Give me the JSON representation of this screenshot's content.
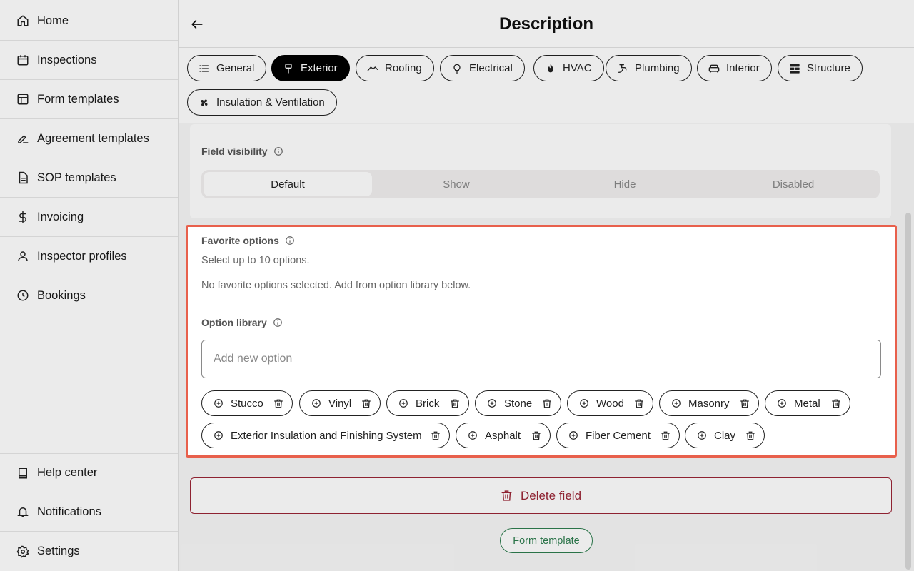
{
  "sidebar": {
    "items": [
      {
        "label": "Home",
        "icon": "home-icon"
      },
      {
        "label": "Inspections",
        "icon": "calendar-icon"
      },
      {
        "label": "Form templates",
        "icon": "layout-icon"
      },
      {
        "label": "Agreement templates",
        "icon": "signature-icon"
      },
      {
        "label": "SOP templates",
        "icon": "document-icon"
      },
      {
        "label": "Invoicing",
        "icon": "dollar-icon"
      },
      {
        "label": "Inspector profiles",
        "icon": "user-icon"
      },
      {
        "label": "Bookings",
        "icon": "clock-icon"
      }
    ],
    "bottom_items": [
      {
        "label": "Help center",
        "icon": "book-icon"
      },
      {
        "label": "Notifications",
        "icon": "bell-icon"
      },
      {
        "label": "Settings",
        "icon": "gear-icon"
      }
    ]
  },
  "header": {
    "title": "Description"
  },
  "tabs": [
    {
      "label": "General",
      "icon": "list-icon"
    },
    {
      "label": "Exterior",
      "icon": "brush-icon",
      "active": true
    },
    {
      "label": "Roofing",
      "icon": "roof-icon"
    },
    {
      "label": "Electrical",
      "icon": "lightbulb-icon"
    },
    {
      "label": "HVAC",
      "icon": "flame-icon"
    },
    {
      "label": "Plumbing",
      "icon": "faucet-icon"
    },
    {
      "label": "Interior",
      "icon": "sofa-icon"
    },
    {
      "label": "Structure",
      "icon": "bricks-icon"
    },
    {
      "label": "Insulation & Ventilation",
      "icon": "fan-icon"
    }
  ],
  "field_visibility": {
    "label": "Field visibility",
    "options": [
      "Default",
      "Show",
      "Hide",
      "Disabled"
    ],
    "selected": "Default"
  },
  "favorite_options": {
    "label": "Favorite options",
    "hint": "Select up to 10 options.",
    "empty_text": "No favorite options selected. Add from option library below."
  },
  "option_library": {
    "label": "Option library",
    "input_placeholder": "Add new option",
    "options": [
      "Stucco",
      "Vinyl",
      "Brick",
      "Stone",
      "Wood",
      "Masonry",
      "Metal",
      "Exterior Insulation and Finishing System",
      "Asphalt",
      "Fiber Cement",
      "Clay"
    ]
  },
  "actions": {
    "delete_field": "Delete field",
    "form_template": "Form template"
  },
  "colors": {
    "highlight": "#e8604c",
    "danger": "#9b2536",
    "success": "#2e7d4f"
  }
}
